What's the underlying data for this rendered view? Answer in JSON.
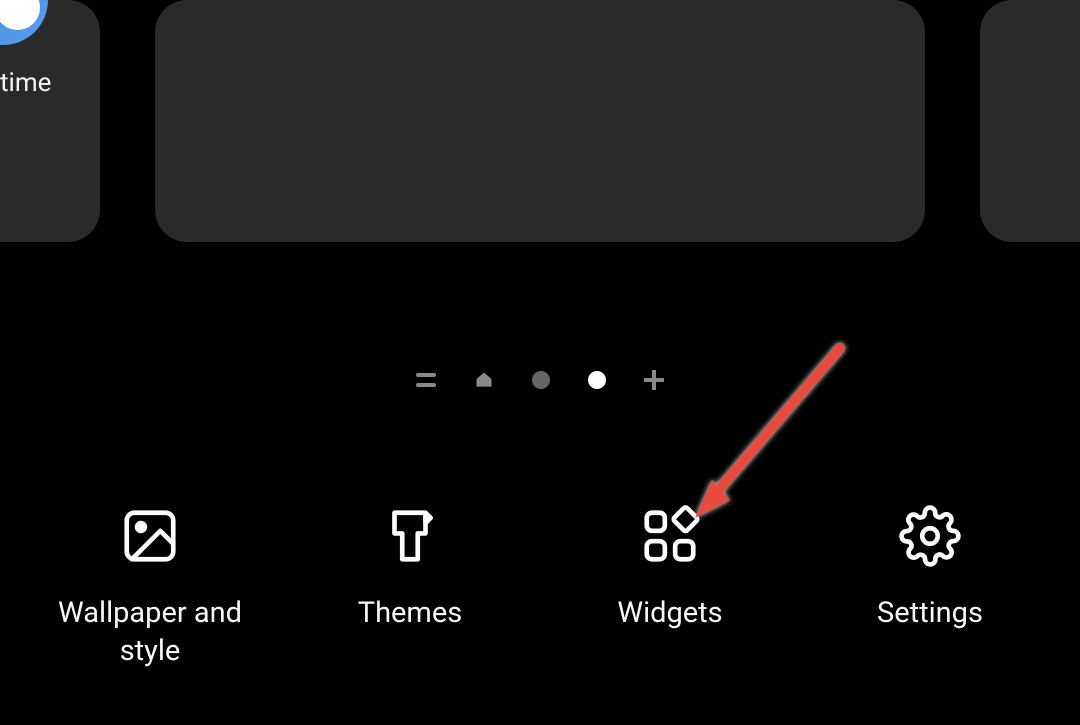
{
  "app_preview": {
    "visible_label": "time"
  },
  "menu": {
    "wallpaper": "Wallpaper and style",
    "themes": "Themes",
    "widgets": "Widgets",
    "settings": "Settings"
  }
}
